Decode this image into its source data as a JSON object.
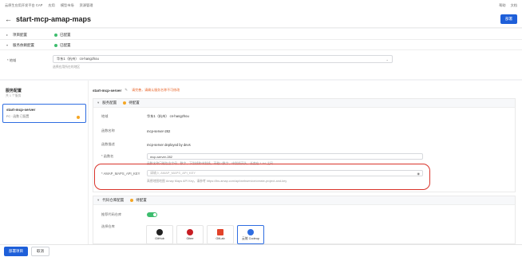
{
  "topnav": {
    "items": [
      "云原生应用开发平台 CAP",
      "应用",
      "模型市场",
      "资源管理"
    ],
    "right_items": [
      "帮助",
      "文档"
    ]
  },
  "header": {
    "back_icon": "arrow-left-icon",
    "title": "start-mcp-amap-maps",
    "deploy_label": "部署"
  },
  "sections": {
    "first_label": "项目配置",
    "first_status": "已配置",
    "second_label": "服务依赖配置",
    "second_status": "已配置"
  },
  "region": {
    "label": "* 地域",
    "value": "华东1（杭州）  cn-hangzhou",
    "hint": "选择应用所在的地区"
  },
  "left_panel": {
    "title": "服务配置",
    "subtitle": "共 1 个服务",
    "card_name": "start-mcp-server",
    "card_sub": "FC · 函数  已配置"
  },
  "main": {
    "service_name": "start-mcp-server",
    "notice": "请完善，请确认服务名称不可修改",
    "service_box": {
      "title": "服务配置",
      "status": "待配置",
      "rows": [
        {
          "k": "地域",
          "v": "华东1（杭州）  cn-hangzhou"
        },
        {
          "k": "函数名称",
          "v": "mcp-server-282"
        },
        {
          "k": "函数描述",
          "v": "mcp-server deployed by devs"
        }
      ],
      "fn_label": "* 函数名",
      "fn_value": "mcp-server-282",
      "fn_hint": "函数名称只能包含字母、数字、下划线和中划线，不能以数字、中划线开头，长度在 1-64 之间",
      "key_label": "* AMAP_MAPS_API_KEY",
      "key_placeholder": "请输入 AMAP_MAPS_API_KEY",
      "key_hint": "高德地图地图 Amap Maps API Key，请参考 https://lbs.amap.com/api/webservice/create-project-and-key"
    },
    "code_box": {
      "title": "代码仓库配置",
      "status": "待配置",
      "toggle_label": "推荐代码仓库",
      "repo_label": "选择仓库",
      "repos": [
        "GitHub",
        "Gitee",
        "GitLab",
        "云效 Codeup"
      ]
    }
  },
  "footer": {
    "deploy_label": "部署项目",
    "cancel_label": "取消"
  },
  "colors": {
    "primary": "#1e5fd9",
    "success": "#3dbd6e",
    "warning": "#f5a623",
    "highlight": "#d9342b"
  }
}
